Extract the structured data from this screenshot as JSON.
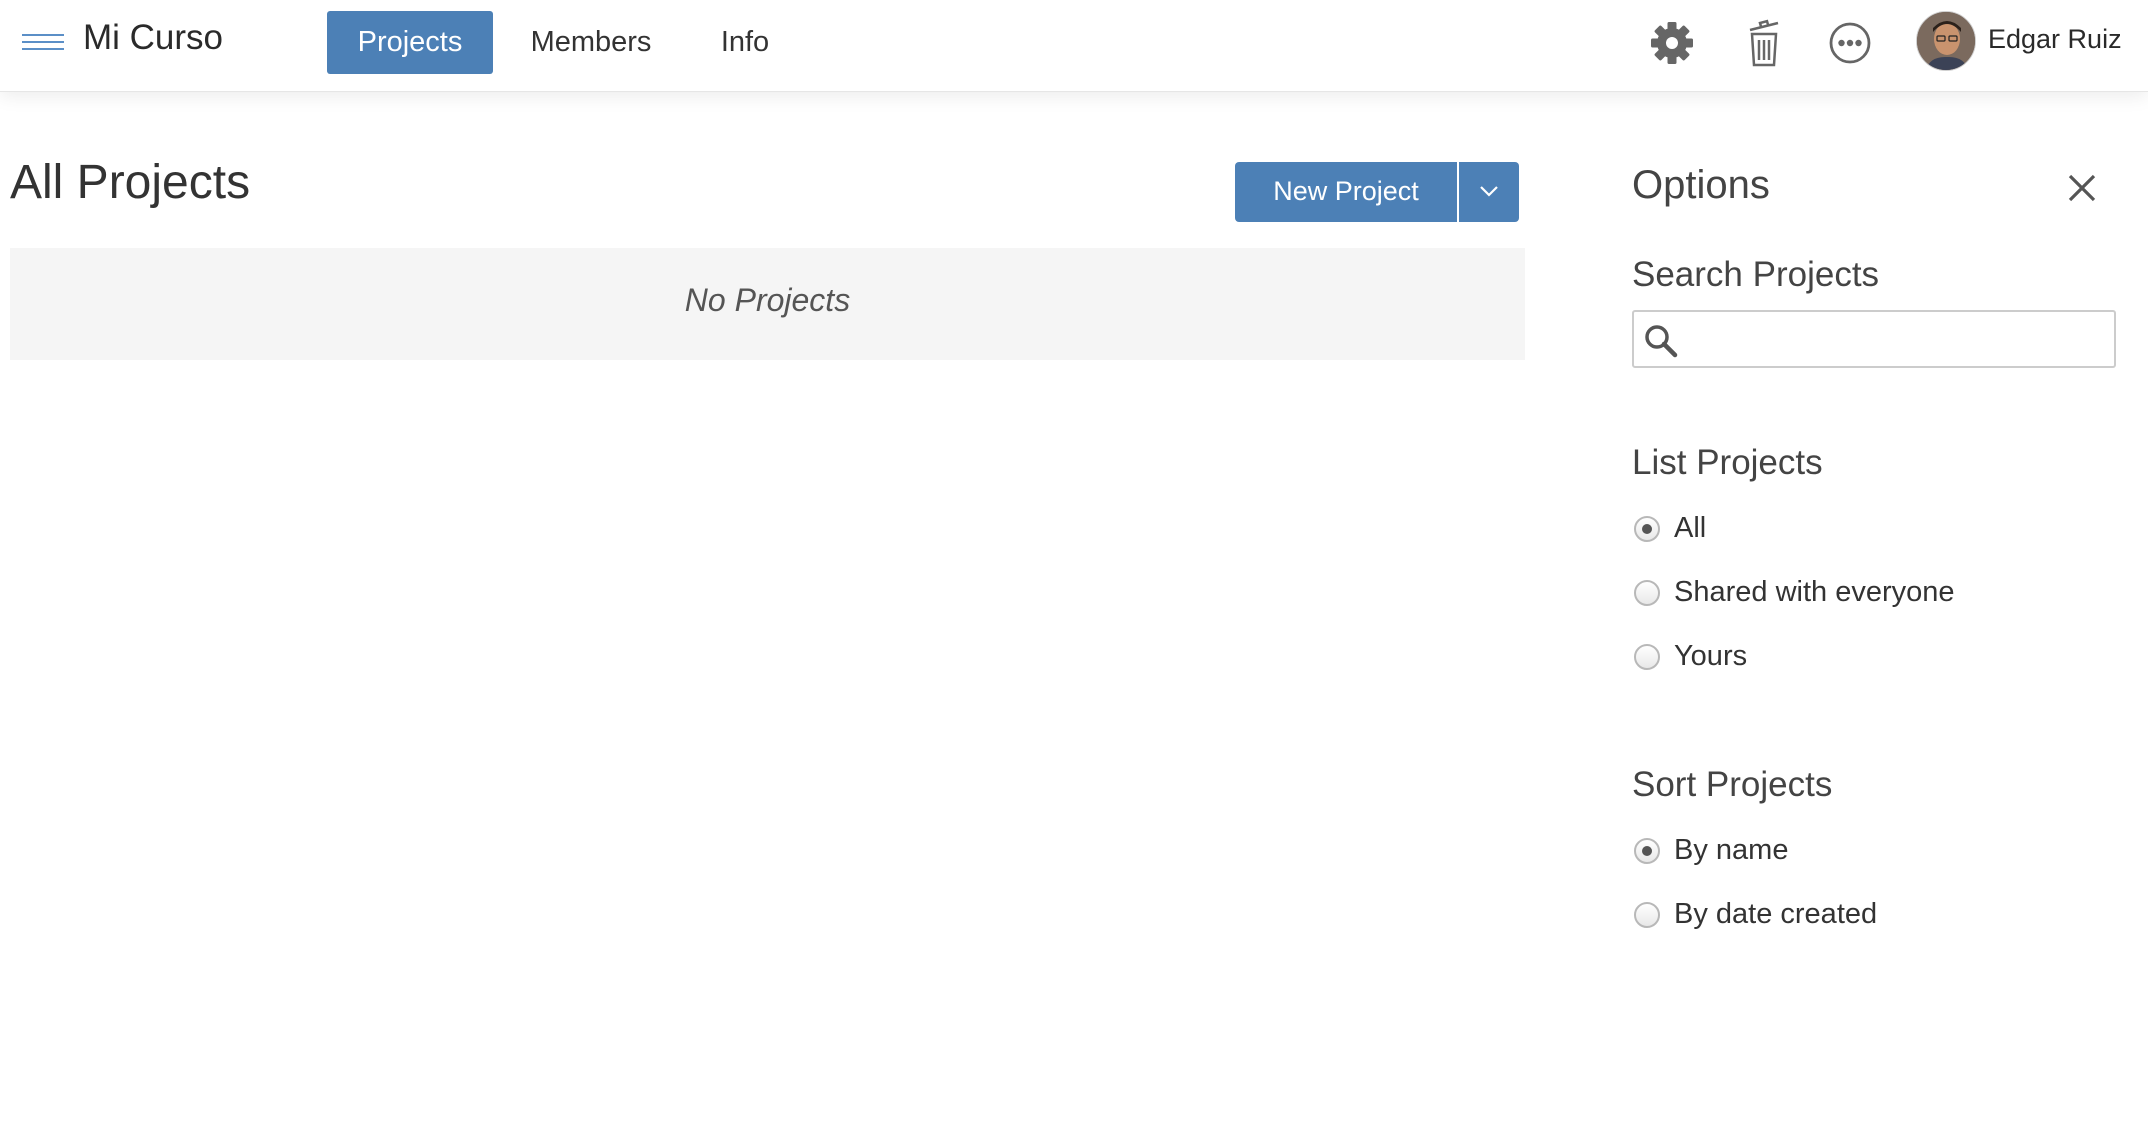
{
  "header": {
    "app_title": "Mi Curso",
    "tabs": [
      {
        "label": "Projects",
        "active": true
      },
      {
        "label": "Members",
        "active": false
      },
      {
        "label": "Info",
        "active": false
      }
    ],
    "icons": [
      "menu-icon",
      "gear-icon",
      "trash-icon",
      "more-icon"
    ],
    "user_name": "Edgar Ruiz"
  },
  "main": {
    "title": "All Projects",
    "new_button_label": "New Project",
    "empty_message": "No Projects"
  },
  "options": {
    "title": "Options",
    "search_label": "Search Projects",
    "search_value": "",
    "list_label": "List Projects",
    "list_options": [
      {
        "label": "All",
        "checked": true
      },
      {
        "label": "Shared with everyone",
        "checked": false
      },
      {
        "label": "Yours",
        "checked": false
      }
    ],
    "sort_label": "Sort Projects",
    "sort_options": [
      {
        "label": "By name",
        "checked": true
      },
      {
        "label": "By date created",
        "checked": false
      }
    ]
  },
  "colors": {
    "accent": "#4c80b6",
    "menu_icon": "#5b8fc7",
    "empty_bg": "#f5f5f5"
  }
}
